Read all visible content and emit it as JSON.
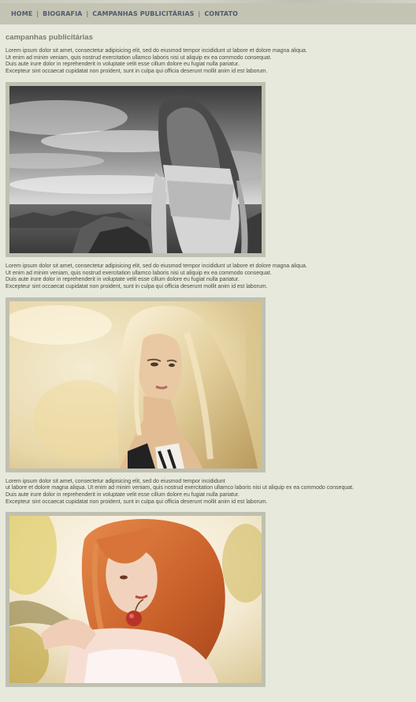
{
  "nav": {
    "items": [
      {
        "label": "HOME"
      },
      {
        "label": "BIOGRAFIA"
      },
      {
        "label": "CAMPANHAS PUBLICITÁRIAS"
      },
      {
        "label": "CONTATO"
      }
    ],
    "separator": "|"
  },
  "page": {
    "title": "campanhas publicitárias"
  },
  "sections": [
    {
      "lines": [
        "Lorem ipsum dolor sit amet, consectetur adipisicing elit, sed do eiusmod tempor incididunt ut labore et dolore magna aliqua.",
        "Ut enim ad minim veniam, quis nostrud exercitation ullamco laboris nisi ut aliquip ex ea commodo consequat.",
        "Duis aute irure dolor in reprehenderit in voluptate velit esse cillum dolore eu fugiat nulla pariatur.",
        "Excepteur sint occaecat cupidatat non proident, sunt in culpa qui officia deserunt mollit anim id est laborum."
      ],
      "photo": {
        "icon": "photo-woman-seaside-bw"
      }
    },
    {
      "lines": [
        "Lorem ipsum dolor sit amet, consectetur adipisicing elit, sed do eiusmod tempor incididunt ut labore et dolore magna aliqua.",
        "Ut enim ad minim veniam, quis nostrud exercitation ullamco laboris nisi ut aliquip ex ea commodo consequat.",
        "Duis aute irure dolor in reprehenderit in voluptate velit esse cillum dolore eu fugiat nulla pariatur.",
        "Excepteur sint occaecat cupidatat non proident, sunt in culpa qui officia deserunt mollit anim id est laborum."
      ],
      "photo": {
        "icon": "photo-blonde-woman-sunlight"
      }
    },
    {
      "lines": [
        "Lorem ipsum dolor sit amet, consectetur adipisicing elit, sed do eiusmod tempor incididunt",
        "ut labore et dolore magna aliqua. Ut enim ad minim veniam, quis nostrud exercitation ullamco laboris nisi ut aliquip ex ea commodo consequat.",
        "Duis aute irure dolor in reprehenderit in voluptate velit esse cillum dolore eu fugiat nulla pariatur.",
        "Excepteur sint occaecat cupidatat non proident, sunt in culpa qui officia deserunt mollit anim id est laborum."
      ],
      "photo": {
        "icon": "photo-redhead-woman-garden"
      }
    }
  ]
}
